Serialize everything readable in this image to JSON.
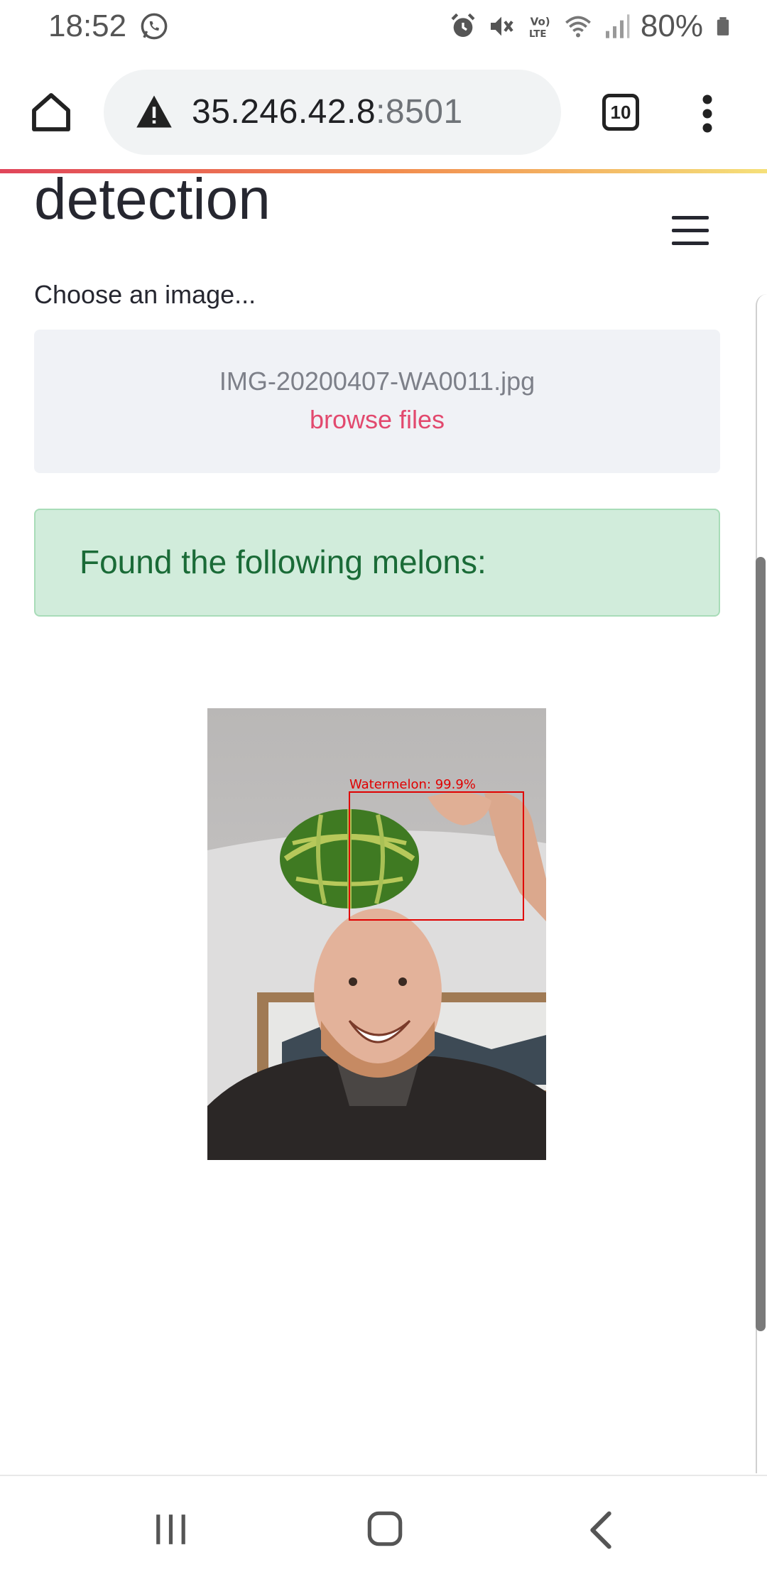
{
  "status_bar": {
    "time": "18:52",
    "battery": "80%",
    "icons": [
      "whatsapp-icon",
      "alarm-icon",
      "mute-icon",
      "volte-icon",
      "wifi-icon",
      "signal-icon",
      "battery-icon"
    ]
  },
  "browser": {
    "url_host": "35.246.42.8",
    "url_port": ":8501",
    "tab_count": "10"
  },
  "page": {
    "title": "detection",
    "upload_label": "Choose an image...",
    "file_name": "IMG-20200407-WA0011.jpg",
    "browse_label": "browse files",
    "success_message": "Found the following melons:",
    "detection": {
      "label": "Watermelon: 99.9%",
      "box_color": "#e00000"
    }
  },
  "colors": {
    "accent": "#e2496e",
    "success_bg": "#d1ecdb",
    "success_text": "#1a6b37"
  }
}
